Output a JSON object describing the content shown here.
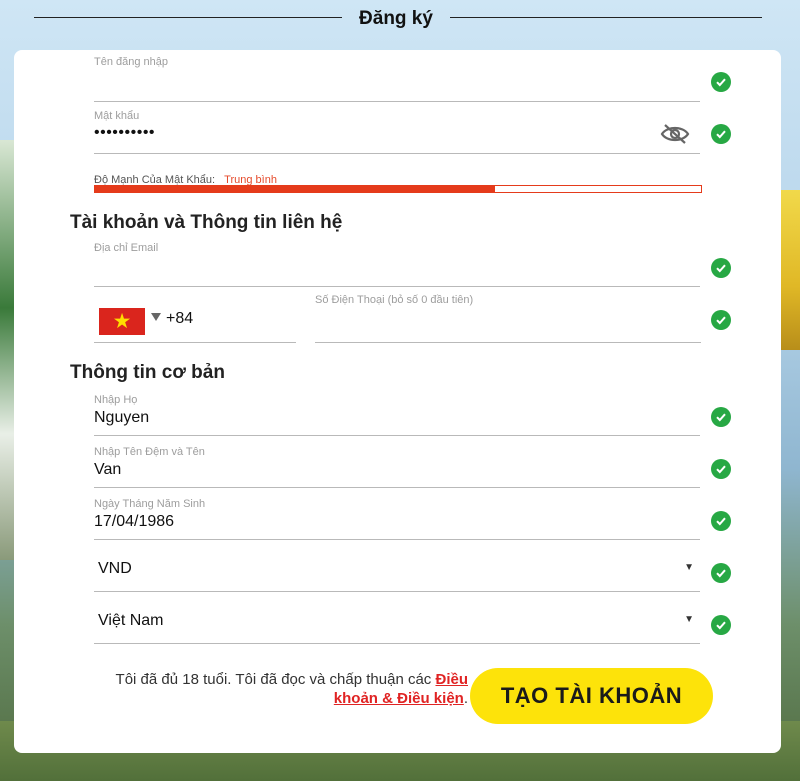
{
  "header": {
    "title": "Đăng ký"
  },
  "fields": {
    "username": {
      "label": "Tên đăng nhập",
      "value": ""
    },
    "password": {
      "label": "Mật khẩu",
      "value": "••••••••••"
    },
    "strength": {
      "label": "Độ Mạnh Của Mật Khẩu:",
      "level": "Trung bình",
      "fraction": 0.66
    },
    "email": {
      "label": "Địa chỉ Email",
      "value": ""
    },
    "phone": {
      "country_code": "+84",
      "label": "Số Điện Thoại (bỏ số 0 đầu tiên)",
      "value": ""
    },
    "last_name": {
      "label": "Nhập Họ",
      "value": "Nguyen"
    },
    "first_name": {
      "label": "Nhập Tên Đệm và Tên",
      "value": "Van"
    },
    "dob": {
      "label": "Ngày Tháng Năm Sinh",
      "value": "17/04/1986"
    },
    "currency": {
      "value": "VND"
    },
    "country": {
      "value": "Việt Nam"
    }
  },
  "sections": {
    "contact": "Tài khoản và Thông tin liên hệ",
    "basic": "Thông tin cơ bản"
  },
  "terms": {
    "text": "Tôi đã đủ 18 tuổi. Tôi đã đọc và chấp thuận các",
    "link": "Điều khoản & Điều kiện",
    "suffix": "."
  },
  "submit_label": "TẠO TÀI KHOẢN",
  "colors": {
    "accent_green": "#27a844",
    "strength_red": "#e53b1b",
    "cta_yellow": "#fde30a",
    "link_red": "#e02323"
  },
  "icons": [
    "check-icon",
    "eye-off-icon",
    "vietnam-flag-icon",
    "dropdown-arrow-icon"
  ]
}
